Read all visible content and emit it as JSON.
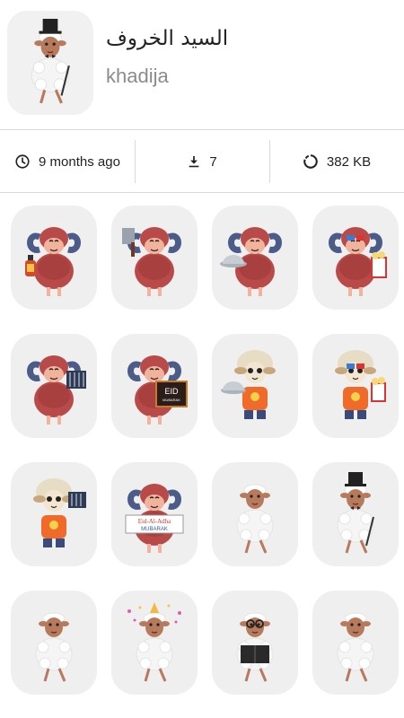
{
  "pack": {
    "title": "السيد الخروف",
    "author": "khadija",
    "icon": "sheep-top-hat-icon"
  },
  "stats": {
    "updated": {
      "icon": "clock-icon",
      "label": "9 months ago"
    },
    "downloads": {
      "icon": "download-icon",
      "label": "7"
    },
    "size": {
      "icon": "storage-icon",
      "label": "382 KB"
    }
  },
  "stickers": [
    {
      "name": "sticker-ram-lantern",
      "kind": "ram",
      "prop": "lantern"
    },
    {
      "name": "sticker-ram-cleaver",
      "kind": "ram",
      "prop": "cleaver"
    },
    {
      "name": "sticker-ram-serving-tray",
      "kind": "ram",
      "prop": "tray"
    },
    {
      "name": "sticker-ram-3d-glasses-popcorn",
      "kind": "ram",
      "prop": "popcorn"
    },
    {
      "name": "sticker-ram-grill",
      "kind": "ram",
      "prop": "grill"
    },
    {
      "name": "sticker-ram-eid-sign",
      "kind": "ram",
      "prop": "eid",
      "sign_text": "EID",
      "sign_sub": "MUBARAK"
    },
    {
      "name": "sticker-lamb-serving-tray",
      "kind": "lamb",
      "prop": "tray"
    },
    {
      "name": "sticker-lamb-3d-glasses-popcorn",
      "kind": "lamb",
      "prop": "popcorn"
    },
    {
      "name": "sticker-lamb-grill",
      "kind": "lamb",
      "prop": "grill"
    },
    {
      "name": "sticker-ram-eid-al-adha-banner",
      "kind": "ram",
      "prop": "banner",
      "banner_line1": "Eid-Al-Adha",
      "banner_line2": "MUBARAK"
    },
    {
      "name": "sticker-sheep-dancing",
      "kind": "sheep",
      "prop": "dance"
    },
    {
      "name": "sticker-sheep-top-hat-cane",
      "kind": "sheep",
      "prop": "tophat"
    },
    {
      "name": "sticker-sheep-walking",
      "kind": "sheep",
      "prop": "walk"
    },
    {
      "name": "sticker-sheep-party",
      "kind": "sheep",
      "prop": "party"
    },
    {
      "name": "sticker-sheep-reading-book",
      "kind": "sheep",
      "prop": "book"
    },
    {
      "name": "sticker-sheep-running",
      "kind": "sheep",
      "prop": "run"
    }
  ]
}
